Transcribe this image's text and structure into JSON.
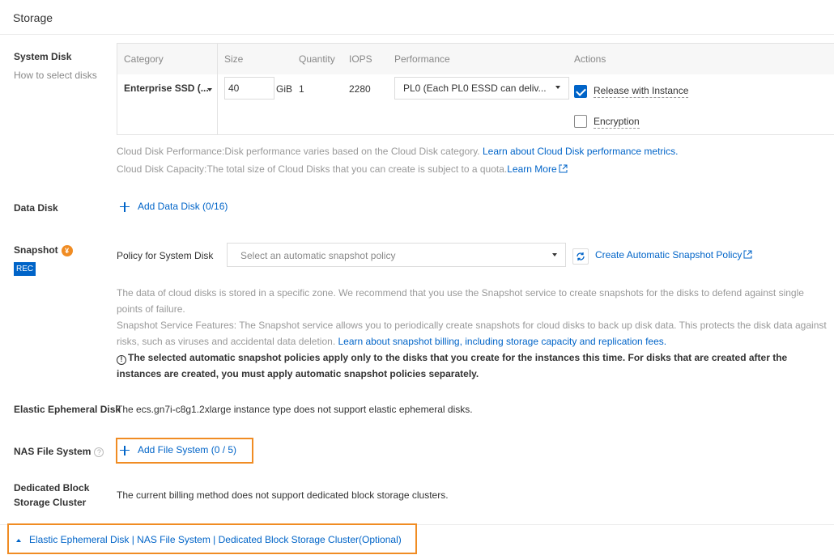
{
  "section_title": "Storage",
  "system_disk": {
    "label": "System Disk",
    "sublabel": "How to select disks",
    "columns": [
      "Category",
      "Size",
      "Quantity",
      "IOPS",
      "Performance",
      "Actions"
    ],
    "category": "Enterprise SSD (...",
    "size": "40",
    "size_unit": "GiB",
    "quantity": "1",
    "iops": "2280",
    "performance": "PL0 (Each PL0 ESSD can deliv...",
    "release_label": "Release with Instance",
    "release_checked": true,
    "encryption_label": "Encryption",
    "encryption_checked": false,
    "perf_hint": "Cloud Disk Performance:Disk performance varies based on the Cloud Disk category. ",
    "perf_link": "Learn about Cloud Disk performance metrics.",
    "capacity_hint": "Cloud Disk Capacity:The total size of Cloud Disks that you can create is subject to a quota.",
    "capacity_link": "Learn More"
  },
  "data_disk": {
    "label": "Data Disk",
    "add_label": "Add Data Disk (0/16)"
  },
  "snapshot": {
    "label": "Snapshot",
    "coin": "¥",
    "badge": "REC",
    "policy_label": "Policy for System Disk",
    "policy_placeholder": "Select an automatic snapshot policy",
    "create_link": "Create Automatic Snapshot Policy",
    "hint1": "The data of cloud disks is stored in a specific zone. We recommend that you use the Snapshot service to create snapshots for the disks to defend against single points of failure.",
    "hint2": "Snapshot Service Features: The Snapshot service allows you to periodically create snapshots for cloud disks to back up disk data. This protects the disk data against risks, such as viruses and accidental data deletion. ",
    "hint2_link": "Learn about snapshot billing, including storage capacity and replication fees.",
    "warning": "The selected automatic snapshot policies apply only to the disks that you create for the instances this time. For disks that are created after the instances are created, you must apply automatic snapshot policies separately."
  },
  "elastic": {
    "label": "Elastic Ephemeral Disk",
    "text": "The ecs.gn7i-c8g1.2xlarge instance type does not support elastic ephemeral disks."
  },
  "nas": {
    "label": "NAS File System",
    "help": "?",
    "add_label": "Add File System (0 / 5)"
  },
  "dedicated": {
    "label_line1": "Dedicated Block",
    "label_line2": "Storage Cluster",
    "text": "The current billing method does not support dedicated block storage clusters."
  },
  "footer_toggle": "Elastic Ephemeral Disk | NAS File System | Dedicated Block Storage Cluster(Optional)",
  "colors": {
    "link": "#0064c8",
    "highlight": "#f08c23"
  }
}
